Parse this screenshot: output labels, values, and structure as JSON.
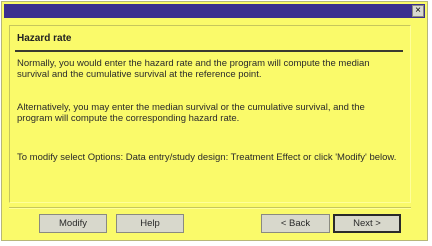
{
  "window": {
    "close_glyph": "×"
  },
  "section": {
    "heading": "Hazard rate",
    "para1": "Normally, you would enter the hazard rate and the program will compute the median survival and the cumulative survival at the reference point.",
    "para2": "Alternatively, you may enter the median survival or the cumulative survival, and the program will compute the corresponding hazard rate.",
    "para3": "To modify select Options: Data entry/study design: Treatment Effect or click 'Modify' below."
  },
  "buttons": {
    "modify": "Modify",
    "help": "Help",
    "back": "< Back",
    "next": "Next >"
  },
  "colors": {
    "background": "#fafa6a",
    "titlebar": "#3b2f8f"
  }
}
